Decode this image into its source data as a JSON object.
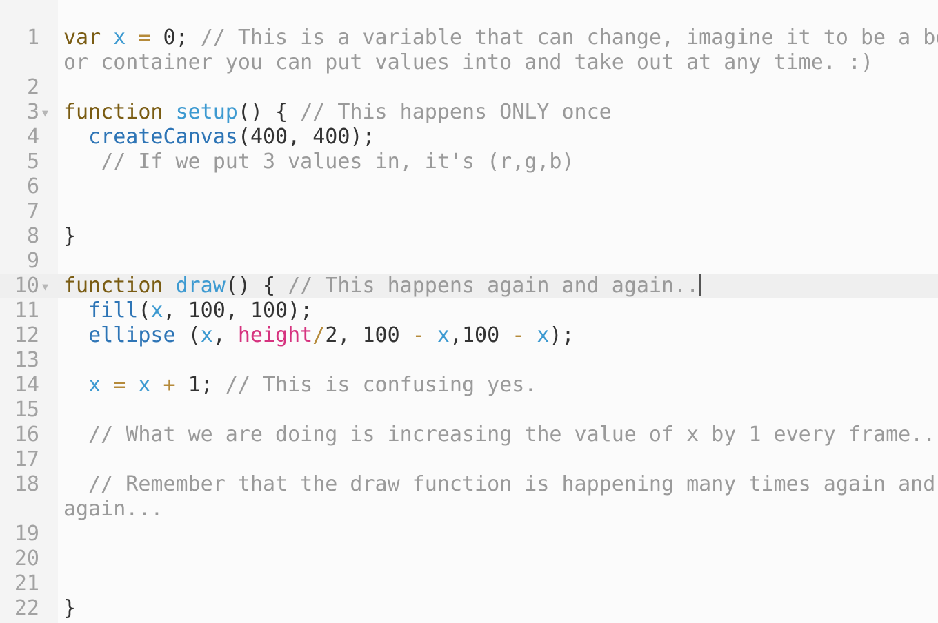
{
  "editor": {
    "lines": [
      {
        "n": "1",
        "tokens": [
          {
            "t": "var",
            "c": "kw"
          },
          {
            "t": " "
          },
          {
            "t": "x",
            "c": "var"
          },
          {
            "t": " "
          },
          {
            "t": "=",
            "c": "op"
          },
          {
            "t": " "
          },
          {
            "t": "0",
            "c": "num"
          },
          {
            "t": "; "
          },
          {
            "t": "// This is a variable that can change, imagine it to be a bo",
            "c": "cmt"
          }
        ],
        "wrap": "or container you can put values into and take out at any time. :)"
      },
      {
        "n": "2",
        "tokens": []
      },
      {
        "n": "3",
        "fold": true,
        "tokens": [
          {
            "t": "function",
            "c": "kw"
          },
          {
            "t": " "
          },
          {
            "t": "setup",
            "c": "def"
          },
          {
            "t": "() { "
          },
          {
            "t": "// This happens ONLY once",
            "c": "cmt"
          }
        ]
      },
      {
        "n": "4",
        "tokens": [
          {
            "t": "  "
          },
          {
            "t": "createCanvas",
            "c": "fn"
          },
          {
            "t": "("
          },
          {
            "t": "400",
            "c": "num"
          },
          {
            "t": ", "
          },
          {
            "t": "400",
            "c": "num"
          },
          {
            "t": ");"
          }
        ]
      },
      {
        "n": "5",
        "tokens": [
          {
            "t": "   "
          },
          {
            "t": "// If we put 3 values in, it's (r,g,b)",
            "c": "cmt"
          }
        ]
      },
      {
        "n": "6",
        "tokens": []
      },
      {
        "n": "7",
        "tokens": []
      },
      {
        "n": "8",
        "tokens": [
          {
            "t": "}"
          }
        ]
      },
      {
        "n": "9",
        "tokens": []
      },
      {
        "n": "10",
        "fold": true,
        "active": true,
        "tokens": [
          {
            "t": "function",
            "c": "kw"
          },
          {
            "t": " "
          },
          {
            "t": "draw",
            "c": "def"
          },
          {
            "t": "() { "
          },
          {
            "t": "// This happens again and again..",
            "c": "cmt"
          }
        ]
      },
      {
        "n": "11",
        "tokens": [
          {
            "t": "  "
          },
          {
            "t": "fill",
            "c": "fn"
          },
          {
            "t": "("
          },
          {
            "t": "x",
            "c": "var"
          },
          {
            "t": ", "
          },
          {
            "t": "100",
            "c": "num"
          },
          {
            "t": ", "
          },
          {
            "t": "100",
            "c": "num"
          },
          {
            "t": ");"
          }
        ]
      },
      {
        "n": "12",
        "tokens": [
          {
            "t": "  "
          },
          {
            "t": "ellipse",
            "c": "fn"
          },
          {
            "t": " ("
          },
          {
            "t": "x",
            "c": "var"
          },
          {
            "t": ", "
          },
          {
            "t": "height",
            "c": "builtin"
          },
          {
            "t": "/",
            "c": "op"
          },
          {
            "t": "2",
            "c": "num"
          },
          {
            "t": ", "
          },
          {
            "t": "100",
            "c": "num"
          },
          {
            "t": " "
          },
          {
            "t": "-",
            "c": "op"
          },
          {
            "t": " "
          },
          {
            "t": "x",
            "c": "var"
          },
          {
            "t": ","
          },
          {
            "t": "100",
            "c": "num"
          },
          {
            "t": " "
          },
          {
            "t": "-",
            "c": "op"
          },
          {
            "t": " "
          },
          {
            "t": "x",
            "c": "var"
          },
          {
            "t": ");"
          }
        ]
      },
      {
        "n": "13",
        "tokens": []
      },
      {
        "n": "14",
        "tokens": [
          {
            "t": "  "
          },
          {
            "t": "x",
            "c": "var"
          },
          {
            "t": " "
          },
          {
            "t": "=",
            "c": "op"
          },
          {
            "t": " "
          },
          {
            "t": "x",
            "c": "var"
          },
          {
            "t": " "
          },
          {
            "t": "+",
            "c": "op"
          },
          {
            "t": " "
          },
          {
            "t": "1",
            "c": "num"
          },
          {
            "t": "; "
          },
          {
            "t": "// This is confusing yes.",
            "c": "cmt"
          }
        ]
      },
      {
        "n": "15",
        "tokens": []
      },
      {
        "n": "16",
        "tokens": [
          {
            "t": "  "
          },
          {
            "t": "// What we are doing is increasing the value of x by 1 every frame..",
            "c": "cmt"
          }
        ]
      },
      {
        "n": "17",
        "tokens": []
      },
      {
        "n": "18",
        "tokens": [
          {
            "t": "  "
          },
          {
            "t": "// Remember that the draw function is happening many times again and",
            "c": "cmt"
          }
        ],
        "wrap": "again..."
      },
      {
        "n": "19",
        "tokens": []
      },
      {
        "n": "20",
        "tokens": []
      },
      {
        "n": "21",
        "tokens": []
      },
      {
        "n": "22",
        "tokens": [
          {
            "t": "}"
          }
        ]
      }
    ]
  }
}
